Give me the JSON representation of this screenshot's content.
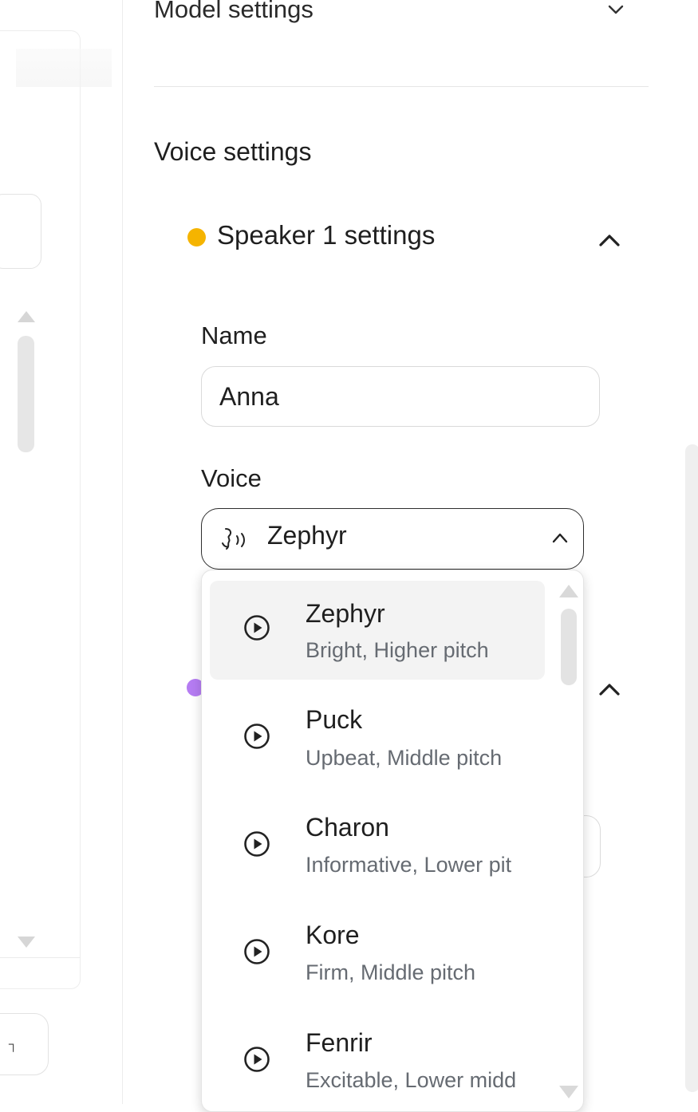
{
  "panel": {
    "model_settings_title": "Model settings",
    "voice_settings_title": "Voice settings"
  },
  "speaker1": {
    "title": "Speaker 1 settings",
    "dot_color": "#f5b400",
    "name_label": "Name",
    "name_value": "Anna",
    "voice_label": "Voice",
    "voice_selected": "Zephyr"
  },
  "speaker2": {
    "dot_color": "#b57cf2"
  },
  "left_panel": {
    "button_glyph": "┐"
  },
  "voice_options": [
    {
      "name": "Zephyr",
      "desc": "Bright, Higher pitch",
      "selected": true
    },
    {
      "name": "Puck",
      "desc": "Upbeat, Middle pitch",
      "selected": false
    },
    {
      "name": "Charon",
      "desc": "Informative, Lower pit",
      "selected": false
    },
    {
      "name": "Kore",
      "desc": "Firm, Middle pitch",
      "selected": false
    },
    {
      "name": "Fenrir",
      "desc": "Excitable, Lower midd",
      "selected": false
    }
  ],
  "icons": {
    "collapse_chevron": "chevron-up-icon",
    "expand_chevron": "chevron-down-icon",
    "play": "play-circle-icon",
    "voice": "voice-wave-icon"
  }
}
